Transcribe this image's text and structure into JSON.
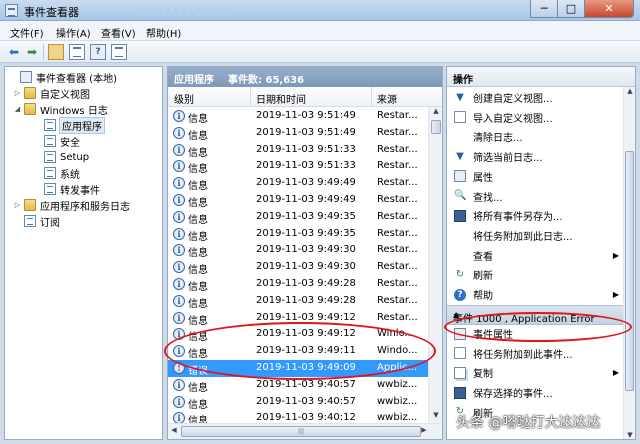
{
  "window": {
    "title": "事件查看器",
    "blurred_tab_text": "· · · · · · · · · · · · ·",
    "min_label": "─",
    "max_label": "□",
    "close_label": "✕"
  },
  "menu": [
    "文件(F)",
    "操作(A)",
    "查看(V)",
    "帮助(H)"
  ],
  "toolbar": {
    "icons": [
      "back-arrow-icon",
      "forward-arrow-icon",
      "up-folder-icon",
      "show-tree-icon",
      "help-icon",
      "event-log-icon"
    ],
    "back_glyph": "⬅",
    "forward_glyph": "➡",
    "help_glyph": "?"
  },
  "tree": {
    "items": [
      {
        "label": "事件查看器 (本地)",
        "exp": "",
        "icon": "viewer"
      },
      {
        "label": "自定义视图",
        "exp": "▷",
        "icon": "folder"
      },
      {
        "label": "Windows 日志",
        "exp": "◢",
        "icon": "folder"
      },
      {
        "label": "应用程序",
        "exp": "",
        "icon": "log"
      },
      {
        "label": "安全",
        "exp": "",
        "icon": "log"
      },
      {
        "label": "Setup",
        "exp": "",
        "icon": "log"
      },
      {
        "label": "系统",
        "exp": "",
        "icon": "log"
      },
      {
        "label": "转发事件",
        "exp": "",
        "icon": "log"
      },
      {
        "label": "应用程序和服务日志",
        "exp": "▷",
        "icon": "folder"
      },
      {
        "label": "订阅",
        "exp": "",
        "icon": "log"
      }
    ]
  },
  "middle": {
    "title": "应用程序",
    "count_label": "事件数: 65,636",
    "columns": {
      "level": "级别",
      "datetime": "日期和时间",
      "source": "来源"
    },
    "rows": [
      {
        "level": "信息",
        "datetime": "2019-11-03 9:51:49",
        "source": "Restar..."
      },
      {
        "level": "信息",
        "datetime": "2019-11-03 9:51:49",
        "source": "Restar..."
      },
      {
        "level": "信息",
        "datetime": "2019-11-03 9:51:33",
        "source": "Restar..."
      },
      {
        "level": "信息",
        "datetime": "2019-11-03 9:51:33",
        "source": "Restar..."
      },
      {
        "level": "信息",
        "datetime": "2019-11-03 9:49:49",
        "source": "Restar..."
      },
      {
        "level": "信息",
        "datetime": "2019-11-03 9:49:49",
        "source": "Restar..."
      },
      {
        "level": "信息",
        "datetime": "2019-11-03 9:49:35",
        "source": "Restar..."
      },
      {
        "level": "信息",
        "datetime": "2019-11-03 9:49:35",
        "source": "Restar..."
      },
      {
        "level": "信息",
        "datetime": "2019-11-03 9:49:30",
        "source": "Restar..."
      },
      {
        "level": "信息",
        "datetime": "2019-11-03 9:49:30",
        "source": "Restar..."
      },
      {
        "level": "信息",
        "datetime": "2019-11-03 9:49:28",
        "source": "Restar..."
      },
      {
        "level": "信息",
        "datetime": "2019-11-03 9:49:28",
        "source": "Restar..."
      },
      {
        "level": "信息",
        "datetime": "2019-11-03 9:49:12",
        "source": "Restar..."
      },
      {
        "level": "信息",
        "datetime": "2019-11-03 9:49:12",
        "source": "Winlo..."
      },
      {
        "level": "信息",
        "datetime": "2019-11-03 9:49:11",
        "source": "Windo..."
      },
      {
        "level": "错误",
        "datetime": "2019-11-03 9:49:09",
        "source": "Applic..."
      },
      {
        "level": "信息",
        "datetime": "2019-11-03 9:40:57",
        "source": "wwbiz..."
      },
      {
        "level": "信息",
        "datetime": "2019-11-03 9:40:57",
        "source": "wwbiz..."
      },
      {
        "level": "信息",
        "datetime": "2019-11-03 9:40:12",
        "source": "wwbiz..."
      }
    ],
    "selected_index": 15,
    "hscroll_grip": "|||"
  },
  "actions": {
    "header": "操作",
    "items": [
      {
        "label": "创建自定义视图...",
        "icon": "filter-icon",
        "glyph": "▼"
      },
      {
        "label": "导入自定义视图...",
        "icon": "import-icon",
        "glyph": ""
      },
      {
        "label": "清除日志...",
        "icon": "",
        "glyph": ""
      },
      {
        "label": "筛选当前日志...",
        "icon": "filter-icon",
        "glyph": "▼"
      },
      {
        "label": "属性",
        "icon": "properties-icon",
        "glyph": ""
      },
      {
        "label": "查找...",
        "icon": "find-icon",
        "glyph": "🔍"
      },
      {
        "label": "将所有事件另存为...",
        "icon": "save-icon",
        "glyph": ""
      },
      {
        "label": "将任务附加到此日志...",
        "icon": "",
        "glyph": ""
      },
      {
        "label": "查看",
        "icon": "",
        "glyph": "",
        "submenu": true
      },
      {
        "label": "刷新",
        "icon": "refresh-icon",
        "glyph": "↻"
      },
      {
        "label": "帮助",
        "icon": "help-icon",
        "glyph": "?",
        "submenu": true
      }
    ],
    "sub_header": "事件 1000 , Application Error",
    "sub_items": [
      {
        "label": "事件属性",
        "icon": "event-properties-icon",
        "glyph": ""
      },
      {
        "label": "将任务附加到此事件...",
        "icon": "attach-task-icon",
        "glyph": ""
      },
      {
        "label": "复制",
        "icon": "copy-icon",
        "glyph": "",
        "submenu": true
      },
      {
        "label": "保存选择的事件...",
        "icon": "save-icon",
        "glyph": ""
      },
      {
        "label": "刷新",
        "icon": "refresh-icon",
        "glyph": "↻"
      }
    ],
    "submenu_arrow": "▶",
    "collapse_arrow": "▲"
  },
  "scroll": {
    "up": "▲",
    "down": "▼",
    "left": "◀",
    "right": "▶"
  },
  "watermark": "头条 @嗒哒打大达达达",
  "colors": {
    "selection": "#3399ff",
    "annotation_red": "#e0141b",
    "header_blue": "#8aa4c4"
  }
}
